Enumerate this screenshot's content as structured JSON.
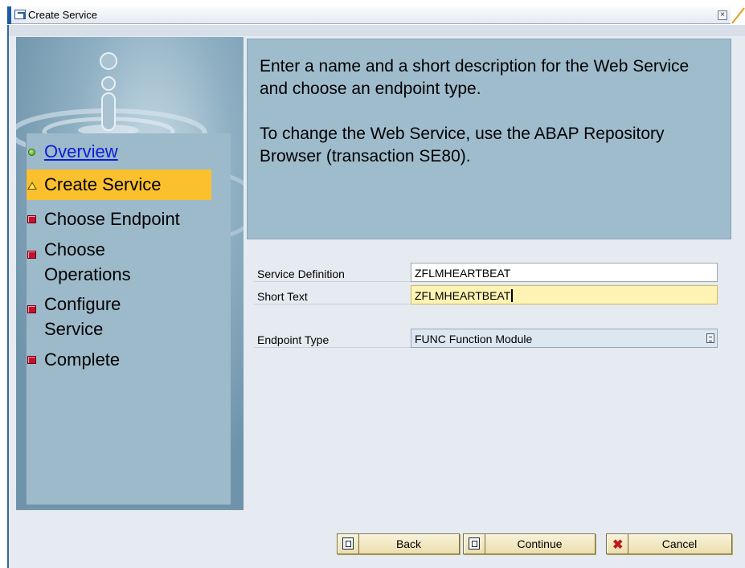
{
  "window": {
    "title": "Create Service",
    "close_glyph": "×"
  },
  "roadmap": {
    "steps": [
      {
        "label": "Overview",
        "status": "done",
        "icon": "green-dot-icon"
      },
      {
        "label": "Create Service",
        "status": "current",
        "icon": "yellow-triangle-icon"
      },
      {
        "label": "Choose Endpoint",
        "status": "pending",
        "icon": "red-square-icon"
      },
      {
        "label_line1": "Choose",
        "label_line2": "Operations",
        "status": "pending",
        "icon": "red-square-icon"
      },
      {
        "label_line1": "Configure",
        "label_line2": "Service",
        "status": "pending",
        "icon": "red-square-icon"
      },
      {
        "label": "Complete",
        "status": "pending",
        "icon": "red-square-icon"
      }
    ]
  },
  "info": {
    "paragraph1": "Enter a name and a short description for the Web Service and choose an endpoint type.",
    "paragraph2": "To change the Web Service, use the ABAP Repository Browser (transaction SE80)."
  },
  "form": {
    "service_definition": {
      "label": "Service Definition",
      "value": "ZFLMHEARTBEAT"
    },
    "short_text": {
      "label": "Short Text",
      "value": "ZFLMHEARTBEAT"
    },
    "endpoint_type": {
      "label": "Endpoint Type",
      "value": "FUNC Function Module"
    }
  },
  "buttons": {
    "back": "Back",
    "continue": "Continue",
    "cancel": "Cancel"
  },
  "colors": {
    "title_accent": "#1c5aa6",
    "active_step": "#fbc02d",
    "info_panel": "#9fbccd",
    "focus_field": "#fff3b3",
    "link": "#0a1ed8"
  }
}
